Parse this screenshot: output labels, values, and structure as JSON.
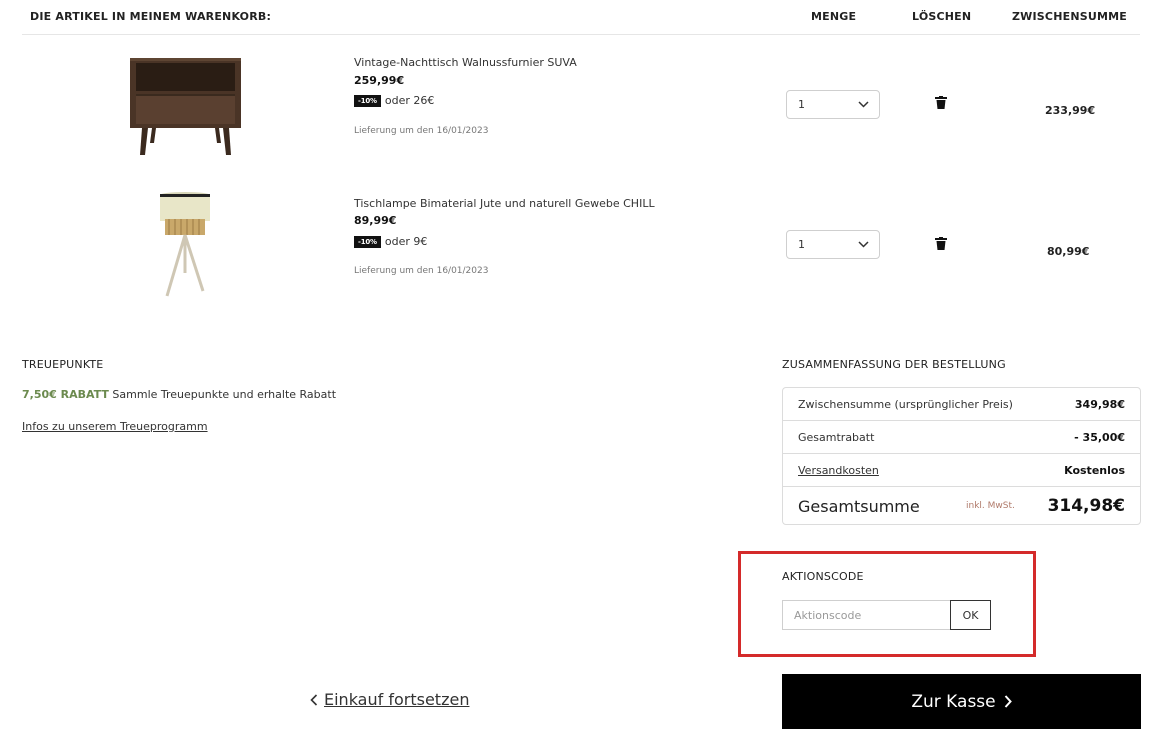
{
  "header": {
    "items_title": "DIE ARTIKEL IN MEINEM WARENKORB:",
    "col_qty": "MENGE",
    "col_delete": "LÖSCHEN",
    "col_subtotal": "ZWISCHENSUMME"
  },
  "items": [
    {
      "name": "Vintage-Nachttisch Walnussfurnier SUVA",
      "price": "259,99€",
      "discount_badge": "-10%",
      "discount_text": "oder 26€",
      "delivery": "Lieferung um den 16/01/2023",
      "quantity": "1",
      "line_total": "233,99€",
      "image_icon": "nightstand-image"
    },
    {
      "name": "Tischlampe Bimaterial Jute und naturell Gewebe CHILL",
      "price": "89,99€",
      "discount_badge": "-10%",
      "discount_text": "oder 9€",
      "delivery": "Lieferung um den 16/01/2023",
      "quantity": "1",
      "line_total": "80,99€",
      "image_icon": "table-lamp-image"
    }
  ],
  "loyalty": {
    "title": "TREUEPUNKTE",
    "discount_amount": "7,50€ RABATT",
    "discount_text": "Sammle Treuepunkte und erhalte Rabatt",
    "info_link": "Infos zu unserem Treueprogramm",
    "accent_color": "#6b8a4e"
  },
  "summary": {
    "title": "ZUSAMMENFASSUNG DER BESTELLUNG",
    "subtotal_label": "Zwischensumme (ursprünglicher Preis)",
    "subtotal_value": "349,98€",
    "discount_label": "Gesamtrabatt",
    "discount_value": "- 35,00€",
    "shipping_label": "Versandkosten",
    "shipping_value": "Kostenlos",
    "total_label": "Gesamtsumme",
    "vat_note": "inkl. MwSt.",
    "total_value": "314,98€"
  },
  "promo": {
    "title": "AKTIONSCODE",
    "placeholder": "Aktionscode",
    "button": "OK",
    "highlight_color": "#d42a2a"
  },
  "actions": {
    "continue_shopping": "Einkauf fortsetzen",
    "checkout": "Zur Kasse"
  },
  "icons": {
    "trash": "trash-icon",
    "chevron_down": "chevron-down-icon",
    "chevron_left": "chevron-left-icon",
    "chevron_right": "chevron-right-icon"
  }
}
